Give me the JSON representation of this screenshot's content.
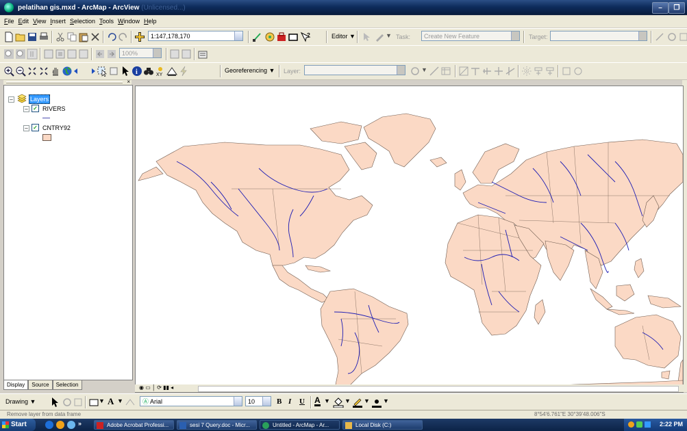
{
  "window": {
    "title": "pelatihan gis.mxd - ArcMap - ArcView",
    "ghost_title": "(Unlicensed...)",
    "controls": {
      "minimize": "–",
      "restore": "❐",
      "close": "×"
    }
  },
  "menubar": {
    "items": [
      {
        "label": "File",
        "u": "F",
        "rest": "ile"
      },
      {
        "label": "Edit",
        "u": "E",
        "rest": "dit"
      },
      {
        "label": "View",
        "u": "V",
        "rest": "iew"
      },
      {
        "label": "Insert",
        "u": "I",
        "rest": "nsert"
      },
      {
        "label": "Selection",
        "u": "S",
        "rest": "election"
      },
      {
        "label": "Tools",
        "u": "T",
        "rest": "ools"
      },
      {
        "label": "Window",
        "u": "W",
        "rest": "indow"
      },
      {
        "label": "Help",
        "u": "H",
        "rest": "elp"
      }
    ]
  },
  "standard_toolbar": {
    "scale": "1:147,178,170",
    "editor_label": "Editor",
    "task_label": "Task:",
    "task_value": "Create New Feature",
    "target_label": "Target:",
    "target_value": ""
  },
  "layout_toolbar": {
    "zoom_value": "100%"
  },
  "tools_toolbar": {
    "georeferencing_label": "Georeferencing",
    "layer_label": "Layer:",
    "layer_value": ""
  },
  "toc": {
    "root_label": "Layers",
    "layers": [
      {
        "name": "RIVERS",
        "checked": true,
        "symbol": "line",
        "color": "#4b4bb0"
      },
      {
        "name": "CNTRY92",
        "checked": true,
        "symbol": "fill",
        "color": "#fbd9c5"
      }
    ],
    "tabs": [
      "Display",
      "Source",
      "Selection"
    ],
    "active_tab": "Display"
  },
  "map": {
    "land_color": "#fbd9c5",
    "outline_color": "#6e5a4e",
    "river_color": "#1c1cb4",
    "background": "#ffffff"
  },
  "drawing_toolbar": {
    "drawing_label": "Drawing",
    "font_name": "Arial",
    "font_size": "10",
    "bold": "B",
    "italic": "I",
    "underline": "U"
  },
  "status": {
    "message": "Remove layer from data frame",
    "coordinates": "8°54'6.761\"E  30°39'48.006\"S"
  },
  "taskbar": {
    "start": "Start",
    "buttons": [
      {
        "label": "Adobe Acrobat Professi...",
        "color": "#c22"
      },
      {
        "label": "sesi 7 Query.doc - Micr...",
        "color": "#2a5fb0"
      },
      {
        "label": "Untitled - ArcMap - Ar...",
        "color": "#2aa05a"
      },
      {
        "label": "Local Disk (C:)",
        "color": "#e8b84a"
      }
    ],
    "clock": "2:22 PM"
  }
}
